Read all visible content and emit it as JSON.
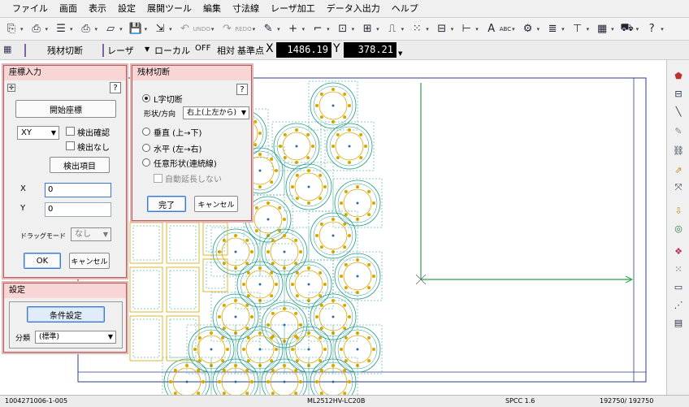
{
  "menu": [
    "ファイル",
    "画面",
    "表示",
    "設定",
    "展開ツール",
    "編集",
    "寸法線",
    "レーザ加工",
    "データ入出力",
    "ヘルプ"
  ],
  "toolbar_icons": [
    "cad-import-icon",
    "cam-import-icon",
    "list-icon",
    "print-icon",
    "eraser-icon",
    "save-icon",
    "export-icon",
    "undo-icon",
    "redo-icon",
    "pen-icon",
    "plus-icon",
    "rect-icon",
    "frame-icon",
    "grid-icon",
    "step-icon",
    "dots-icon",
    "pattern-icon",
    "measure-icon",
    "abc-icon",
    "gear-icon",
    "layers-icon",
    "hierarchy-icon",
    "nest-icon",
    "truck-icon",
    "help-icon"
  ],
  "toolbar_labels": {
    "undo": "UNDO",
    "redo": "REDO",
    "abc": "ABC"
  },
  "modebar": {
    "mode_label": "残材切断",
    "layer_label": "レーザ",
    "local_label": "ローカル",
    "off_label": "OFF",
    "relative_label": "相対",
    "base_label": "基準点",
    "x_label": "X",
    "x_value": "1486.19",
    "y_label": "Y",
    "y_value": "378.21"
  },
  "coord_dialog": {
    "title": "座標入力",
    "start_button": "開始座標",
    "mode_select": "XY",
    "check_detect": "検出確認",
    "check_nodetect": "検出なし",
    "detect_item_button": "検出項目",
    "x_label": "X",
    "x_value": "0",
    "y_label": "Y",
    "y_value": "0",
    "drag_label": "ドラッグモード",
    "drag_value": "なし",
    "ok": "OK",
    "cancel": "キャンセル"
  },
  "settings_panel": {
    "title": "設定",
    "condition_button": "条件設定",
    "category_label": "分類",
    "category_value": "(標準)"
  },
  "cut_dialog": {
    "title": "残材切断",
    "opt_l": "L字切断",
    "shape_label": "形状/方向",
    "shape_value": "右上(上左から)",
    "opt_vertical": "垂直 (上→下)",
    "opt_horizontal": "水平 (左→右)",
    "opt_free": "任意形状(連続線)",
    "auto_extend": "自動延長しない",
    "finish": "完了",
    "cancel": "キャンセル"
  },
  "status": {
    "id": "1004271006-1-005",
    "machine": "ML2512HV-LC20B",
    "material": "SPCC 1.6",
    "count": "192750/ 192750"
  },
  "colors": {
    "part_outline": "#1f9a8a",
    "hole": "#d8a600",
    "cut_line": "#2aa24a",
    "sheet": "#2b3f8a",
    "dialog_border": "#b06060"
  }
}
